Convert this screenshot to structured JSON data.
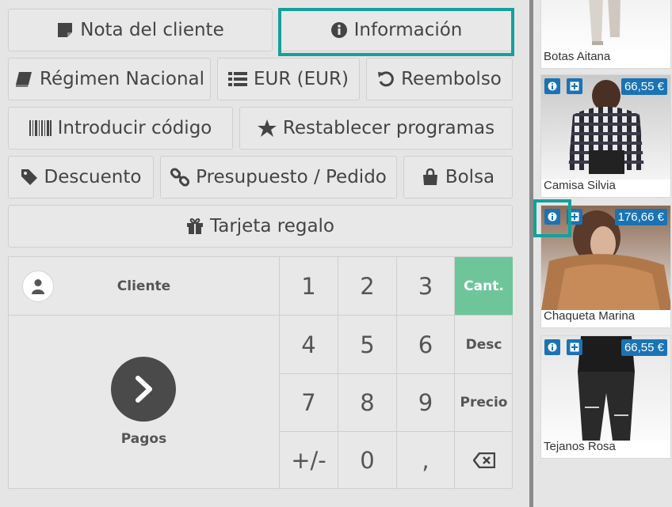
{
  "buttons": {
    "note": "Nota del cliente",
    "info": "Información",
    "regime": "Régimen Nacional",
    "currency": "EUR (EUR)",
    "refund": "Reembolso",
    "code": "Introducir código",
    "reset": "Restablecer programas",
    "discount": "Descuento",
    "quote": "Presupuesto / Pedido",
    "bag": "Bolsa",
    "giftcard": "Tarjeta regalo"
  },
  "numpad": {
    "customer": "Cliente",
    "payments": "Pagos",
    "keys": [
      "1",
      "2",
      "3",
      "4",
      "5",
      "6",
      "7",
      "8",
      "9",
      "+/-",
      "0",
      ","
    ],
    "mode_qty": "Cant.",
    "mode_disc": "Desc",
    "mode_price": "Precio"
  },
  "products": [
    {
      "name": "Botas Aitana",
      "price": ""
    },
    {
      "name": "Camisa Silvia",
      "price": "66,55 €"
    },
    {
      "name": "Chaqueta Marina",
      "price": "176,66 €"
    },
    {
      "name": "Tejanos Rosa",
      "price": "66,55 €"
    }
  ],
  "colors": {
    "accent": "#13a19a",
    "mode_active": "#6ec59a",
    "badge": "#1a73b4"
  }
}
